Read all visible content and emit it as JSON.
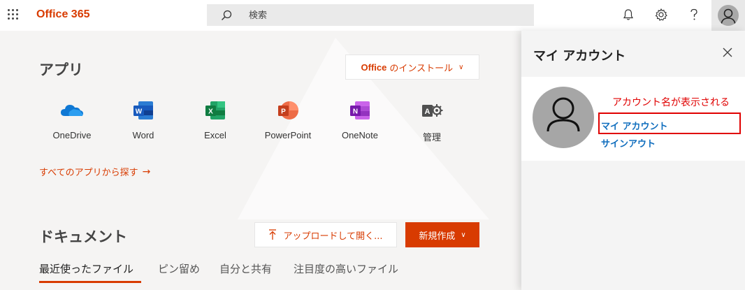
{
  "topbar": {
    "brand": "Office 365",
    "search_placeholder": "検索"
  },
  "apps_section": {
    "heading": "アプリ",
    "install_brand": "Office",
    "install_label": "のインストール",
    "apps": [
      {
        "label": "OneDrive",
        "icon": "onedrive-icon"
      },
      {
        "label": "Word",
        "icon": "word-icon"
      },
      {
        "label": "Excel",
        "icon": "excel-icon"
      },
      {
        "label": "PowerPoint",
        "icon": "powerpoint-icon"
      },
      {
        "label": "OneNote",
        "icon": "onenote-icon"
      },
      {
        "label": "管理",
        "icon": "admin-icon"
      }
    ],
    "all_apps_link": "すべてのアプリから探す",
    "all_apps_arrow": "→"
  },
  "documents_section": {
    "heading": "ドキュメント",
    "upload_label": "アップロードして開く...",
    "new_label": "新規作成",
    "tabs": [
      "最近使ったファイル",
      "ピン留め",
      "自分と共有",
      "注目度の高いファイル"
    ],
    "active_tab": 0
  },
  "account_panel": {
    "title": "マイ アカウント",
    "annotation": "アカウント名が表示される",
    "my_account_link": "マイ アカウント",
    "sign_out_link": "サインアウト"
  },
  "colors": {
    "brand": "#d83b01",
    "link": "#106ebe",
    "annotation": "#e00000"
  }
}
